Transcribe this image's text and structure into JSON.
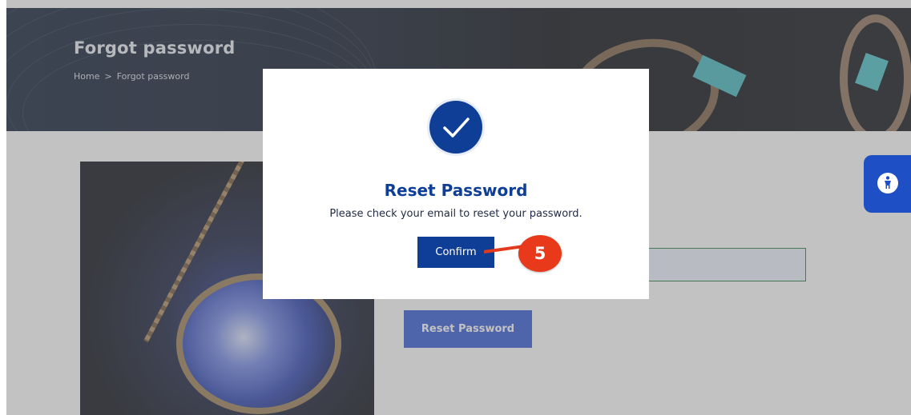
{
  "hero": {
    "title": "Forgot password",
    "breadcrumb": {
      "home": "Home",
      "separator": ">",
      "current": "Forgot password"
    }
  },
  "form": {
    "email_value": "",
    "reset_button_label": "Reset Password"
  },
  "modal": {
    "icon": "checkmark-icon",
    "title": "Reset Password",
    "message": "Please check your email to reset your password.",
    "confirm_label": "Confirm"
  },
  "annotation": {
    "step_number": "5"
  },
  "accessibility": {
    "icon": "accessibility-person-icon"
  },
  "colors": {
    "primary": "#0f3e96",
    "accent_button": "#2f56d6",
    "callout": "#e8391b"
  }
}
